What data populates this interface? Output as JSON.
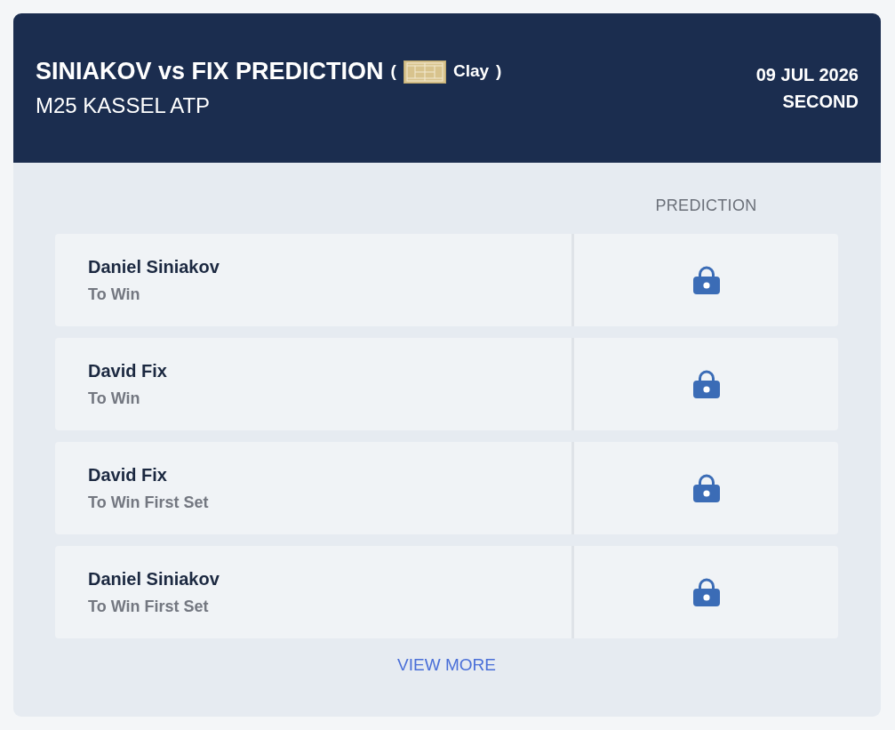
{
  "header": {
    "title": "SINIAKOV vs FIX PREDICTION",
    "surface": {
      "open_paren": "(",
      "label": "Clay",
      "close_paren": ")"
    },
    "tournament": "M25 KASSEL ATP",
    "date": "09 JUL 2026",
    "round": "SECOND"
  },
  "table": {
    "column_header": "PREDICTION",
    "rows": [
      {
        "player": "Daniel Siniakov",
        "market": "To Win",
        "locked": true
      },
      {
        "player": "David Fix",
        "market": "To Win",
        "locked": true
      },
      {
        "player": "David Fix",
        "market": "To Win First Set",
        "locked": true
      },
      {
        "player": "Daniel Siniakov",
        "market": "To Win First Set",
        "locked": true
      }
    ]
  },
  "view_more": "VIEW MORE"
}
